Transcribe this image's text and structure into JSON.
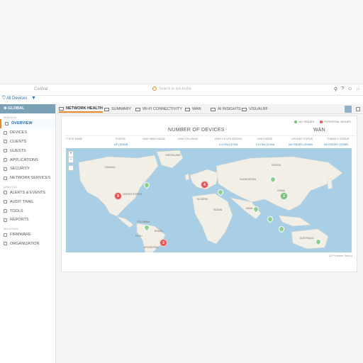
{
  "topbar": {
    "site": "Central",
    "search_placeholder": "Search or ask Aruba"
  },
  "subbar": {
    "scope": "All Devices"
  },
  "sidebar": {
    "global": "GLOBAL",
    "sections": {
      "manage": "MANAGE",
      "analyze": "ANALYZE",
      "maintain": "MAINTAIN"
    },
    "items": [
      {
        "label": "OVERVIEW",
        "active": true
      },
      {
        "label": "DEVICES"
      },
      {
        "label": "CLIENTS"
      },
      {
        "label": "GUESTS"
      },
      {
        "label": "APPLICATIONS"
      },
      {
        "label": "SECURITY"
      },
      {
        "label": "NETWORK SERVICES"
      },
      {
        "label": "ALERTS & EVENTS"
      },
      {
        "label": "AUDIT TRAIL"
      },
      {
        "label": "TOOLS"
      },
      {
        "label": "REPORTS"
      },
      {
        "label": "FIRMWARE"
      },
      {
        "label": "ORGANIZATION"
      }
    ]
  },
  "tabs": [
    {
      "label": "NETWORK HEALTH",
      "active": true
    },
    {
      "label": "SUMMARY"
    },
    {
      "label": "WI-FI CONNECTIVITY"
    },
    {
      "label": "WAN"
    },
    {
      "label": "AI INSIGHTS"
    },
    {
      "label": "VISUALRF"
    }
  ],
  "legend": {
    "no_issues": "NO ISSUES",
    "potential_issues": "POTENTIAL ISSUES",
    "colors": {
      "ok": "#79c07f",
      "issue": "#e05656"
    }
  },
  "panel": {
    "number_of_devices": "NUMBER OF DEVICES",
    "wan": "WAN",
    "columns": [
      {
        "label": "SITE NAME",
        "value": ""
      },
      {
        "label": "STATUS",
        "value": "UP | DOWN"
      },
      {
        "label": "HIGH MEM USAGE",
        "value": ""
      },
      {
        "label": "HIGH CH USAGE",
        "value": ""
      },
      {
        "label": "HIGH CH UTILIZATION",
        "value": "2.4 GHz | 5 GHz"
      },
      {
        "label": "HIGH NOISE",
        "value": "2.4 GHz | 5 GHz"
      },
      {
        "label": "UPLINKS STATUS",
        "value": "NO ISSUES | DOWN"
      },
      {
        "label": "TUNNELS STATUS",
        "value": "NO ISSUES | DOWN"
      }
    ],
    "footer": "22 Problem Site(s)"
  },
  "map": {
    "zoom_in": "+",
    "zoom_out": "−",
    "clusters": [
      {
        "count": "9",
        "status": "issue"
      },
      {
        "count": "4",
        "status": "issue"
      },
      {
        "count": "3",
        "status": "issue"
      },
      {
        "count": "2",
        "status": "ok"
      }
    ],
    "labels": [
      "GREENLAND",
      "RUSSIA",
      "CANADA",
      "UNITED STATES",
      "BRAZIL",
      "CHINA",
      "INDIA",
      "AUSTRALIA",
      "ALGERIA",
      "ARGENTINA",
      "KAZAKHSTAN",
      "PERU",
      "COLOMBIA",
      "SUDAN"
    ]
  }
}
